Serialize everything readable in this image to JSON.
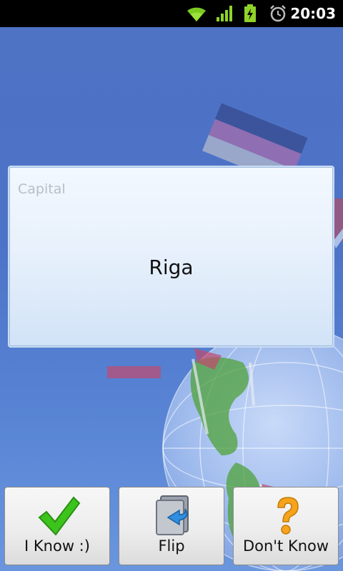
{
  "status_bar": {
    "time": "20:03",
    "icons": [
      "wifi-icon",
      "signal-icon",
      "battery-charging-icon",
      "alarm-icon"
    ]
  },
  "card": {
    "label": "Capital",
    "value": "Riga"
  },
  "buttons": {
    "know": "I Know :)",
    "flip": "Flip",
    "dont_know": "Don't Know"
  },
  "colors": {
    "background": "#4e72c4",
    "card": "#e8f1fc",
    "check_green": "#3cc41d",
    "question_orange": "#f6a41b"
  }
}
